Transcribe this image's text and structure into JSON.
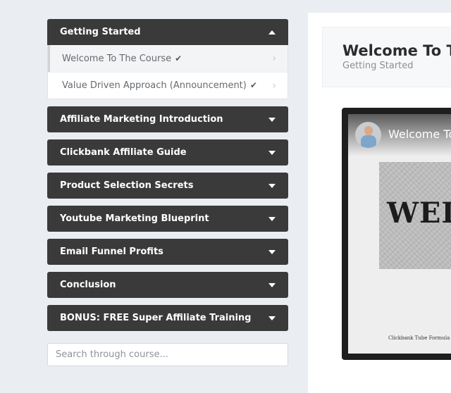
{
  "sidebar": {
    "sections": [
      {
        "title": "Getting Started",
        "open": true,
        "lessons": [
          {
            "label": "Welcome To The Course",
            "check": "✔"
          },
          {
            "label": "Value Driven Approach (Announcement)",
            "check": "✔"
          }
        ]
      },
      {
        "title": "Affiliate Marketing Introduction",
        "open": false
      },
      {
        "title": "Clickbank Affiliate Guide",
        "open": false
      },
      {
        "title": "Product Selection Secrets",
        "open": false
      },
      {
        "title": "Youtube Marketing Blueprint",
        "open": false
      },
      {
        "title": "Email Funnel Profits",
        "open": false
      },
      {
        "title": "Conclusion",
        "open": false
      },
      {
        "title": "BONUS: FREE Super Affiliate Training",
        "open": false
      }
    ],
    "search_placeholder": "Search through course..."
  },
  "main": {
    "lesson_title": "Welcome To The Course",
    "lesson_section": "Getting Started",
    "video": {
      "title": "Welcome To the Course",
      "slide_word": "WELCOME",
      "footer": "Clickbank Tube Formula"
    }
  },
  "icons": {
    "caret_up": "caret-up-icon",
    "caret_down": "caret-down-icon",
    "check": "checkmark-icon",
    "chevron": "chevron-right-icon"
  },
  "colors": {
    "header_bg": "#3a3a3a",
    "page_bg": "#eaedf1"
  }
}
